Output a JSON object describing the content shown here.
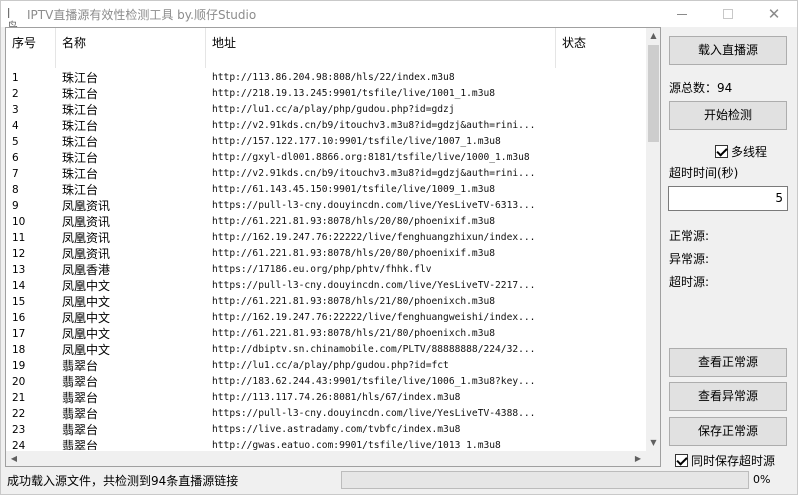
{
  "window": {
    "title": "IPTV直播源有效性检测工具 by.顺仔Studio",
    "app_icon": "ǀ鸟"
  },
  "list": {
    "columns": [
      "序号",
      "名称",
      "地址",
      "状态"
    ],
    "rows": [
      {
        "idx": "1",
        "name": "珠江台",
        "url": "http://113.86.204.98:808/hls/22/index.m3u8",
        "status": ""
      },
      {
        "idx": "2",
        "name": "珠江台",
        "url": "http://218.19.13.245:9901/tsfile/live/1001_1.m3u8",
        "status": ""
      },
      {
        "idx": "3",
        "name": "珠江台",
        "url": "http://lu1.cc/a/play/php/gudou.php?id=gdzj",
        "status": ""
      },
      {
        "idx": "4",
        "name": "珠江台",
        "url": "http://v2.91kds.cn/b9/itouchv3.m3u8?id=gdzj&auth=rini...",
        "status": ""
      },
      {
        "idx": "5",
        "name": "珠江台",
        "url": "http://157.122.177.10:9901/tsfile/live/1007_1.m3u8",
        "status": ""
      },
      {
        "idx": "6",
        "name": "珠江台",
        "url": "http://gxyl-dl001.8866.org:8181/tsfile/live/1000_1.m3u8",
        "status": ""
      },
      {
        "idx": "7",
        "name": "珠江台",
        "url": "http://v2.91kds.cn/b9/itouchv3.m3u8?id=gdzj&auth=rini...",
        "status": ""
      },
      {
        "idx": "8",
        "name": "珠江台",
        "url": "http://61.143.45.150:9901/tsfile/live/1009_1.m3u8",
        "status": ""
      },
      {
        "idx": "9",
        "name": "凤凰资讯",
        "url": "https://pull-l3-cny.douyincdn.com/live/YesLiveTV-6313...",
        "status": ""
      },
      {
        "idx": "10",
        "name": "凤凰资讯",
        "url": "http://61.221.81.93:8078/hls/20/80/phoenixif.m3u8",
        "status": ""
      },
      {
        "idx": "11",
        "name": "凤凰资讯",
        "url": "http://162.19.247.76:22222/live/fenghuangzhixun/index...",
        "status": ""
      },
      {
        "idx": "12",
        "name": "凤凰资讯",
        "url": "http://61.221.81.93:8078/hls/20/80/phoenixif.m3u8",
        "status": ""
      },
      {
        "idx": "13",
        "name": "凤凰香港",
        "url": "https://17186.eu.org/php/phtv/fhhk.flv",
        "status": ""
      },
      {
        "idx": "14",
        "name": "凤凰中文",
        "url": "https://pull-l3-cny.douyincdn.com/live/YesLiveTV-2217...",
        "status": ""
      },
      {
        "idx": "15",
        "name": "凤凰中文",
        "url": "http://61.221.81.93:8078/hls/21/80/phoenixch.m3u8",
        "status": ""
      },
      {
        "idx": "16",
        "name": "凤凰中文",
        "url": "http://162.19.247.76:22222/live/fenghuangweishi/index...",
        "status": ""
      },
      {
        "idx": "17",
        "name": "凤凰中文",
        "url": "http://61.221.81.93:8078/hls/21/80/phoenixch.m3u8",
        "status": ""
      },
      {
        "idx": "18",
        "name": "凤凰中文",
        "url": "http://dbiptv.sn.chinamobile.com/PLTV/88888888/224/32...",
        "status": ""
      },
      {
        "idx": "19",
        "name": "翡翠台",
        "url": "http://lu1.cc/a/play/php/gudou.php?id=fct",
        "status": ""
      },
      {
        "idx": "20",
        "name": "翡翠台",
        "url": "http://183.62.244.43:9901/tsfile/live/1006_1.m3u8?key...",
        "status": ""
      },
      {
        "idx": "21",
        "name": "翡翠台",
        "url": "http://113.117.74.26:8081/hls/67/index.m3u8",
        "status": ""
      },
      {
        "idx": "22",
        "name": "翡翠台",
        "url": "https://pull-l3-cny.douyincdn.com/live/YesLiveTV-4388...",
        "status": ""
      },
      {
        "idx": "23",
        "name": "翡翠台",
        "url": "https://live.astradamy.com/tvbfc/index.m3u8",
        "status": ""
      },
      {
        "idx": "24",
        "name": "翡翠台",
        "url": "http://gwas.eatuo.com:9901/tsfile/live/1013_1.m3u8",
        "status": ""
      }
    ]
  },
  "panel": {
    "load_button": "载入直播源",
    "total_label": "源总数：94",
    "start_button": "开始检测",
    "multithread_label": "多线程",
    "multithread_checked": true,
    "timeout_label": "超时时间(秒)",
    "timeout_value": "5",
    "normal_label": "正常源:",
    "abnormal_label": "异常源:",
    "timeout_src_label": "超时源:",
    "view_normal_button": "查看正常源",
    "view_abnormal_button": "查看异常源",
    "save_normal_button": "保存正常源",
    "save_timeout_label": "同时保存超时源",
    "save_timeout_checked": true
  },
  "statusbar": {
    "message": "成功载入源文件，共检测到94条直播源链接",
    "progress": 0,
    "progress_text": "0%"
  },
  "colors": {
    "progress_fill": "#06b025"
  }
}
